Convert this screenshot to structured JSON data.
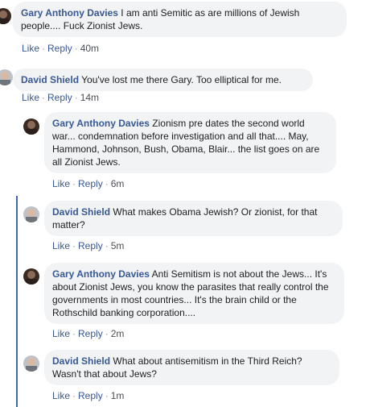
{
  "comments": [
    {
      "author": "Gary Anthony Davies",
      "text": "I am anti Semitic as are millions of Jewish people.... Fuck Zionist Jews.",
      "actions": {
        "like": "Like",
        "reply": "Reply",
        "time": "40m"
      }
    },
    {
      "author": "David Shield",
      "text": "You've lost me there Gary. Too elliptical for me.",
      "actions": {
        "like": "Like",
        "reply": "Reply",
        "time": "14m"
      }
    },
    {
      "author": "Gary Anthony Davies",
      "text": "Zionism pre dates the second world war... condemnation before investigation and all that.... May, Hammond, Johnson, Bush, Obama, Blair... the list goes on are all Zionist Jews.",
      "actions": {
        "like": "Like",
        "reply": "Reply",
        "time": "6m"
      }
    },
    {
      "author": "David Shield",
      "text": "What makes Obama Jewish? Or zionist, for that matter?",
      "actions": {
        "like": "Like",
        "reply": "Reply",
        "time": "5m"
      }
    },
    {
      "author": "Gary Anthony Davies",
      "text": "Anti Semitism is not about the Jews... It's about Zionist Jews, you know the parasites that really control the governments in most countries... It's the brain child or the Rothschild banking corporation....",
      "actions": {
        "like": "Like",
        "reply": "Reply",
        "time": "2m"
      }
    },
    {
      "author": "David Shield",
      "text": "What about antisemitism in the Third Reich? Wasn't that about Jews?",
      "actions": {
        "like": "Like",
        "reply": "Reply",
        "time": "1m"
      }
    }
  ],
  "separator": "·"
}
